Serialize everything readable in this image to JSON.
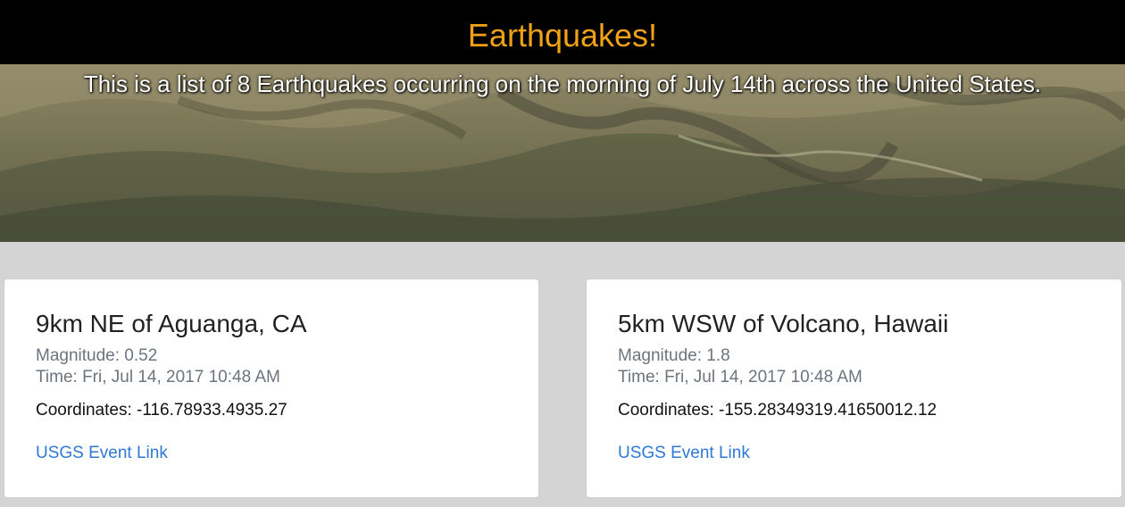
{
  "header": {
    "title": "Earthquakes!",
    "subtitle": "This is a list of 8 Earthquakes occurring on the morning of July 14th across the United States."
  },
  "cards": [
    {
      "title": "9km NE of Aguanga, CA",
      "magnitude": "Magnitude: 0.52",
      "time": "Time: Fri, Jul 14, 2017 10:48 AM",
      "coordinates": "Coordinates: -116.78933.4935.27",
      "link_label": "USGS Event Link"
    },
    {
      "title": "5km WSW of Volcano, Hawaii",
      "magnitude": "Magnitude: 1.8",
      "time": "Time: Fri, Jul 14, 2017 10:48 AM",
      "coordinates": "Coordinates: -155.28349319.41650012.12",
      "link_label": "USGS Event Link"
    }
  ],
  "colors": {
    "title": "#f0a214",
    "link": "#2f79d6",
    "page_background": "#d4d4d4",
    "header_bar": "#000000"
  }
}
